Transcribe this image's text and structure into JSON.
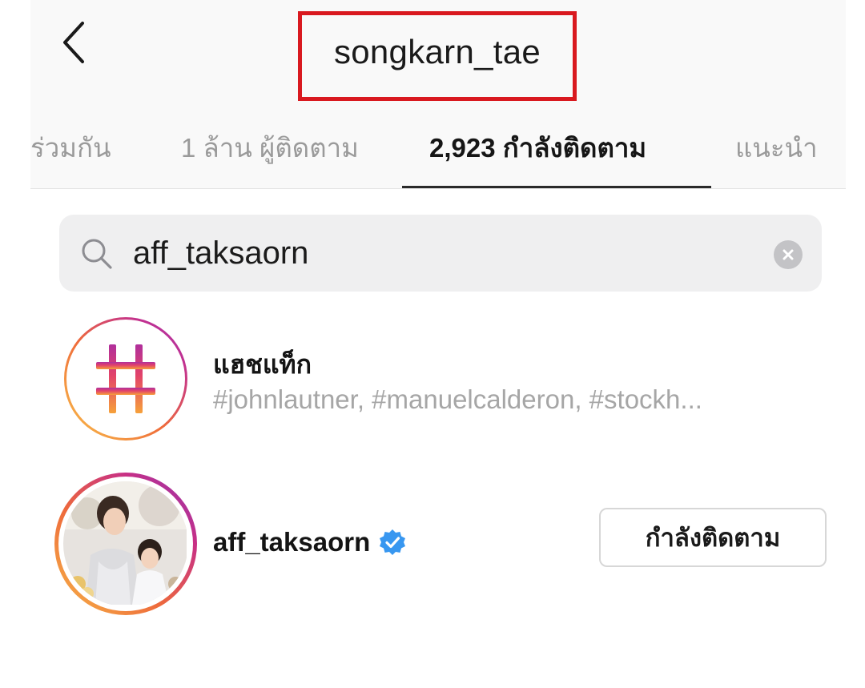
{
  "header": {
    "title": "songkarn_tae",
    "back_icon": "chevron-left-icon",
    "highlight_color": "#d9191f"
  },
  "tabs": [
    {
      "label": "ร่วมกัน",
      "active": false
    },
    {
      "label": "1 ล้าน ผู้ติดตาม",
      "active": false
    },
    {
      "label": "2,923 กำลังติดตาม",
      "active": true
    },
    {
      "label": "แนะนำ",
      "active": false
    }
  ],
  "search": {
    "value": "aff_taksaorn",
    "icon": "search-icon",
    "clear_icon": "clear-icon"
  },
  "results": {
    "hashtag": {
      "title": "แฮชแท็ก",
      "subtitle": "#johnlautner, #manuelcalderon, #stockh...",
      "icon": "hashtag-icon"
    },
    "user": {
      "username": "aff_taksaorn",
      "verified_icon": "verified-badge-icon",
      "verified_color": "#3897f0",
      "button_label": "กำลังติดตาม"
    }
  }
}
